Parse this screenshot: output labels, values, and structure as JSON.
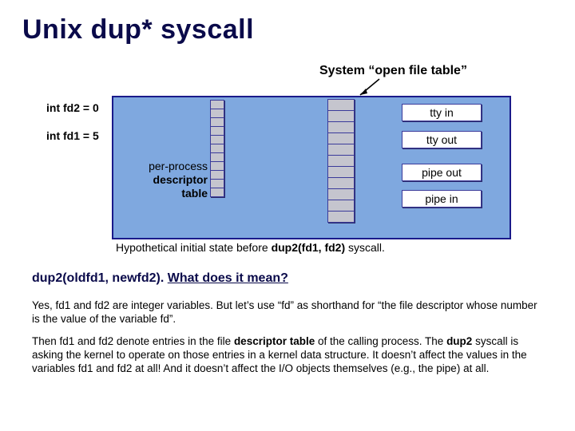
{
  "title": "Unix dup* syscall",
  "oft_label": "System “open file table”",
  "fd2_label": "int fd2 = 0",
  "fd1_label": "int fd1 = 5",
  "ppdt": {
    "l1": "per-process",
    "l2": "descriptor",
    "l3": "table"
  },
  "boxes": {
    "tty_in": "tty in",
    "tty_out": "tty out",
    "pipe_out": "pipe out",
    "pipe_in": "pipe in"
  },
  "caption": {
    "pre": "Hypothetical initial state before ",
    "call": "dup2(fd1, fd2)",
    "post": " syscall."
  },
  "question": {
    "sig": "dup2(oldfd1, newfd2). ",
    "ask": " What does it mean?"
  },
  "para1": "Yes, fd1 and fd2 are integer variables.  But let’s use “fd” as shorthand for “the file descriptor whose number is the value of the variable fd”.",
  "para2_a": "Then fd1 and fd2 denote entries in the file ",
  "para2_b": "descriptor table",
  "para2_c": " of the calling process.  The ",
  "para2_d": "dup2",
  "para2_e": " syscall is asking the kernel to operate on those entries in a kernel data structure.  It doesn’t affect the values in the variables fd1 and fd2 at all!  And it doesn’t affect the I/O objects themselves (e.g., the pipe) at all."
}
